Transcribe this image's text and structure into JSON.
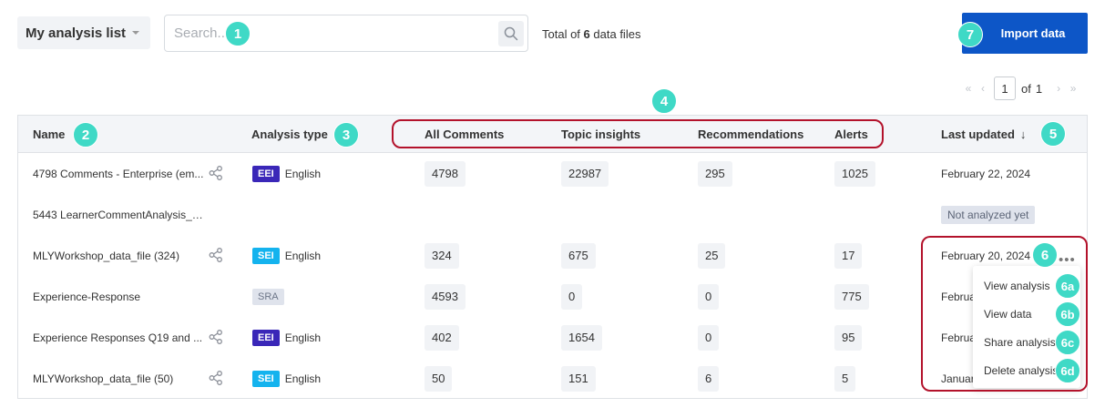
{
  "toolbar": {
    "list_select": "My analysis list",
    "search_placeholder": "Search...",
    "total_prefix": "Total of",
    "total_count": "6",
    "total_suffix": "data files",
    "import_label": "Import data"
  },
  "pager": {
    "current": "1",
    "of": "of",
    "total_pages": "1"
  },
  "table": {
    "headers": {
      "name": "Name",
      "analysis_type": "Analysis type",
      "all_comments": "All Comments",
      "topic_insights": "Topic insights",
      "recommendations": "Recommendations",
      "alerts": "Alerts",
      "last_updated": "Last updated",
      "sort_arrow": "↓"
    },
    "rows": [
      {
        "name": "4798 Comments - Enterprise (em...",
        "badge": "EEI",
        "language": "English",
        "all": "4798",
        "topic": "22987",
        "rec": "295",
        "alerts": "1025",
        "date": "February 22, 2024"
      },
      {
        "name": "5443 LearnerCommentAnalysis_20...",
        "status": "Not analyzed yet"
      },
      {
        "name": "MLYWorkshop_data_file (324)",
        "badge": "SEI",
        "language": "English",
        "all": "324",
        "topic": "675",
        "rec": "25",
        "alerts": "17",
        "date": "February 20, 2024"
      },
      {
        "name": "Experience-Response",
        "badge": "SRA",
        "all": "4593",
        "topic": "0",
        "rec": "0",
        "alerts": "775",
        "date": "Februa"
      },
      {
        "name": "Experience Responses Q19 and ...",
        "badge": "EEI",
        "language": "English",
        "all": "402",
        "topic": "1654",
        "rec": "0",
        "alerts": "95",
        "date": "Februa"
      },
      {
        "name": "MLYWorkshop_data_file (50)",
        "badge": "SEI",
        "language": "English",
        "all": "50",
        "topic": "151",
        "rec": "6",
        "alerts": "5",
        "date": "Januar"
      }
    ]
  },
  "row_menu": {
    "more_glyph": "•••",
    "view_analysis": "View analysis",
    "view_data": "View data",
    "share_analysis": "Share analysis",
    "delete_analysis": "Delete analysis"
  },
  "callouts": {
    "c1": "1",
    "c2": "2",
    "c3": "3",
    "c4": "4",
    "c5": "5",
    "c6": "6",
    "c6a": "6a",
    "c6b": "6b",
    "c6c": "6c",
    "c6d": "6d",
    "c7": "7"
  },
  "colors": {
    "primary": "#0d56c7",
    "callout": "#3fd9c6",
    "highlight_border": "#b3122b",
    "eei_badge": "#3a27b8",
    "sei_badge": "#14b3ee"
  },
  "icons": [
    "search-icon",
    "share-icon",
    "chevron-down-icon",
    "more-icon"
  ]
}
